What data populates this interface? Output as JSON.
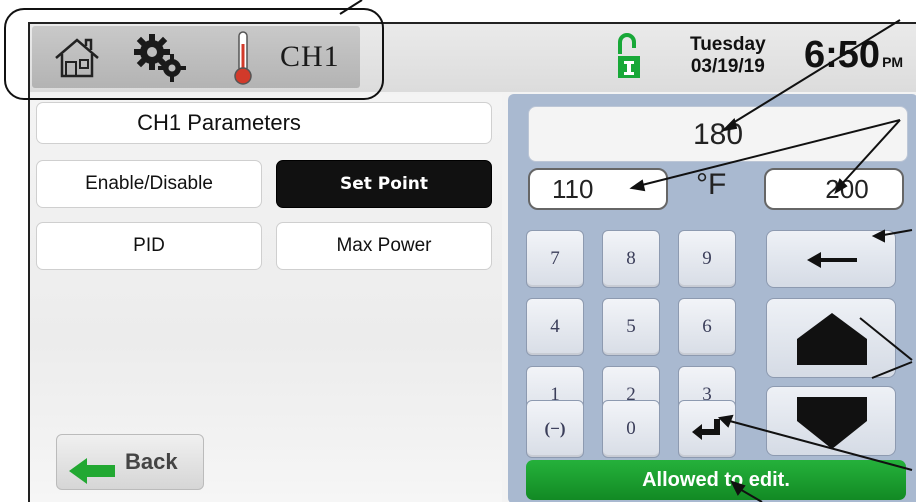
{
  "header": {
    "nav_icons": [
      "home-icon",
      "gear-icon",
      "thermometer-icon"
    ],
    "channel_label": "CH1",
    "lock_icon": "unlock-icon",
    "day": "Tuesday",
    "date": "03/19/19",
    "time": "6:50",
    "ampm": "PM"
  },
  "left": {
    "title": "CH1 Parameters",
    "buttons": {
      "enable_disable": "Enable/Disable",
      "set_point": "Set Point",
      "pid": "PID",
      "max_power": "Max Power"
    },
    "back_label": "Back"
  },
  "keypad": {
    "value": "180",
    "min": "110",
    "max": "200",
    "unit": "°F",
    "keys": [
      "7",
      "8",
      "9",
      "4",
      "5",
      "6",
      "1",
      "2",
      "3",
      "(−)",
      "0"
    ],
    "backspace_icon": "left-arrow-icon",
    "enter_icon": "enter-icon",
    "up_icon": "up-arrow-icon",
    "down_icon": "down-arrow-icon",
    "status": "Allowed to edit."
  },
  "colors": {
    "active_button": "#111111",
    "status_green": "#1a9c2e",
    "lock_green": "#18a838",
    "thermometer_red": "#d23a2a",
    "keypad_panel": "#a9b9d0"
  }
}
